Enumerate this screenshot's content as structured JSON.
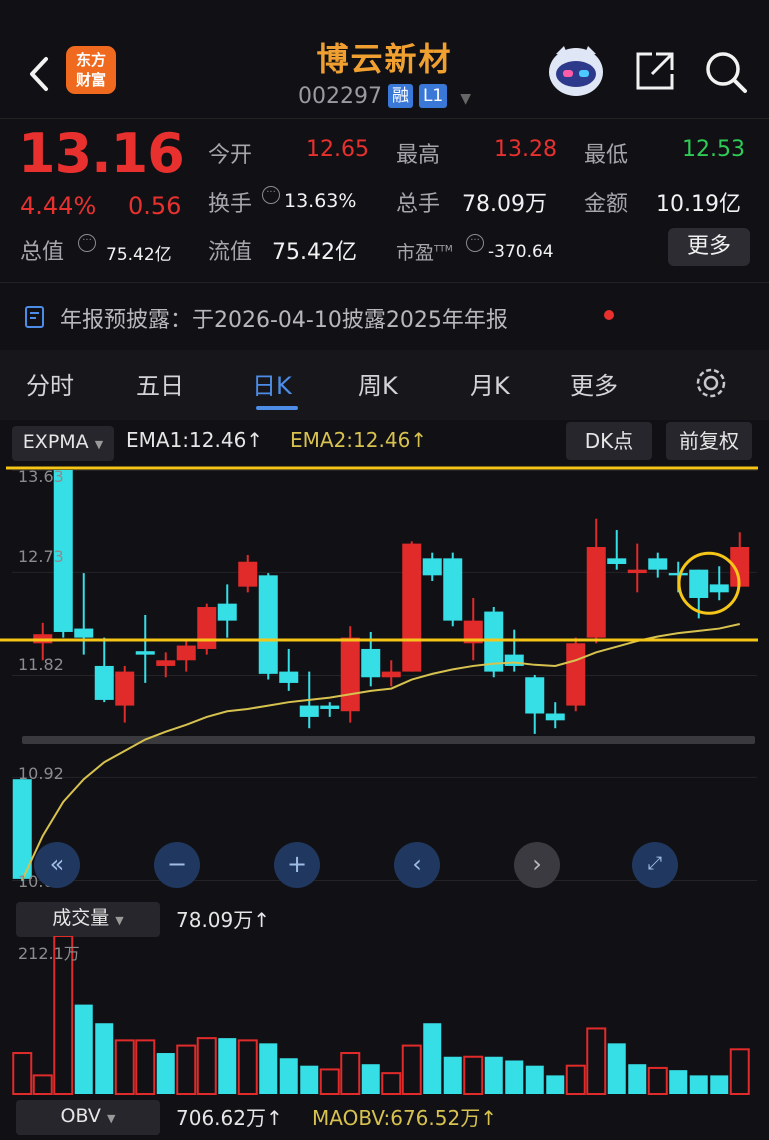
{
  "header": {
    "title": "博云新材",
    "code": "002297",
    "tag_margin": "融",
    "tag_level": "L1",
    "logo_line1": "东方",
    "logo_line2": "财富"
  },
  "quote": {
    "price": "13.16",
    "change_pct": "4.44%",
    "change_amt": "0.56",
    "open_label": "今开",
    "open": "12.65",
    "high_label": "最高",
    "high": "13.28",
    "low_label": "最低",
    "low": "12.53",
    "turnover_label": "换手",
    "turnover": "13.63%",
    "volume_label": "总手",
    "volume": "78.09万",
    "amount_label": "金额",
    "amount": "10.19亿",
    "mktcap_label": "总值",
    "mktcap": "75.42亿",
    "float_label": "流值",
    "float_cap": "75.42亿",
    "pe_label": "市盈",
    "pe_sup": "TTM",
    "pe": "-370.64",
    "more_label": "更多"
  },
  "notice": {
    "text": "年报预披露：于2026-04-10披露2025年年报"
  },
  "tabs": [
    {
      "label": "分时",
      "active": false
    },
    {
      "label": "五日",
      "active": false
    },
    {
      "label": "日K",
      "active": true
    },
    {
      "label": "周K",
      "active": false
    },
    {
      "label": "月K",
      "active": false
    },
    {
      "label": "更多",
      "active": false
    }
  ],
  "indicator": {
    "name": "EXPMA",
    "ema1": "EMA1:12.46",
    "ema2": "EMA2:12.46",
    "arrow": "↑",
    "dk": "DK点",
    "adjust": "前复权"
  },
  "volume_panel": {
    "name": "成交量",
    "value": "78.09万",
    "arrow": "↑",
    "max_label": "212.1万"
  },
  "obv_panel": {
    "name": "OBV",
    "obv": "706.62万",
    "maobv": "MAOBV:676.52万",
    "arrow": "↑"
  },
  "chart_data": {
    "type": "candlestick",
    "y_ticks": [
      "13.63",
      "12.73",
      "11.82",
      "10.92",
      "10.01"
    ],
    "ylim": [
      10.01,
      13.63
    ],
    "candles": [
      {
        "o": 10.9,
        "h": 10.9,
        "l": 10.0,
        "c": 10.02,
        "up": false
      },
      {
        "o": 12.1,
        "h": 12.28,
        "l": 11.95,
        "c": 12.18,
        "up": true
      },
      {
        "o": 13.63,
        "h": 13.63,
        "l": 12.15,
        "c": 12.2,
        "up": false
      },
      {
        "o": 12.23,
        "h": 12.72,
        "l": 12.0,
        "c": 12.15,
        "up": false
      },
      {
        "o": 11.9,
        "h": 12.15,
        "l": 11.58,
        "c": 11.6,
        "up": false
      },
      {
        "o": 11.55,
        "h": 11.9,
        "l": 11.4,
        "c": 11.85,
        "up": true
      },
      {
        "o": 12.0,
        "h": 12.35,
        "l": 11.75,
        "c": 12.03,
        "up": false
      },
      {
        "o": 11.9,
        "h": 12.02,
        "l": 11.8,
        "c": 11.95,
        "up": true
      },
      {
        "o": 11.95,
        "h": 12.12,
        "l": 11.85,
        "c": 12.08,
        "up": true
      },
      {
        "o": 12.05,
        "h": 12.45,
        "l": 12.0,
        "c": 12.42,
        "up": true
      },
      {
        "o": 12.45,
        "h": 12.62,
        "l": 12.15,
        "c": 12.3,
        "up": false
      },
      {
        "o": 12.6,
        "h": 12.88,
        "l": 12.55,
        "c": 12.82,
        "up": true
      },
      {
        "o": 12.7,
        "h": 12.72,
        "l": 11.78,
        "c": 11.83,
        "up": false
      },
      {
        "o": 11.85,
        "h": 12.05,
        "l": 11.68,
        "c": 11.75,
        "up": false
      },
      {
        "o": 11.55,
        "h": 11.85,
        "l": 11.35,
        "c": 11.45,
        "up": false
      },
      {
        "o": 11.52,
        "h": 11.58,
        "l": 11.45,
        "c": 11.55,
        "up": false
      },
      {
        "o": 11.5,
        "h": 12.25,
        "l": 11.4,
        "c": 12.15,
        "up": true
      },
      {
        "o": 12.05,
        "h": 12.2,
        "l": 11.72,
        "c": 11.8,
        "up": false
      },
      {
        "o": 11.8,
        "h": 11.95,
        "l": 11.72,
        "c": 11.85,
        "up": true
      },
      {
        "o": 11.85,
        "h": 13.0,
        "l": 11.85,
        "c": 12.98,
        "up": true
      },
      {
        "o": 12.85,
        "h": 12.9,
        "l": 12.65,
        "c": 12.7,
        "up": false
      },
      {
        "o": 12.85,
        "h": 12.9,
        "l": 12.25,
        "c": 12.3,
        "up": false
      },
      {
        "o": 12.3,
        "h": 12.5,
        "l": 11.95,
        "c": 12.1,
        "up": true
      },
      {
        "o": 12.38,
        "h": 12.42,
        "l": 11.8,
        "c": 11.85,
        "up": false
      },
      {
        "o": 12.0,
        "h": 12.22,
        "l": 11.85,
        "c": 11.9,
        "up": false
      },
      {
        "o": 11.8,
        "h": 11.82,
        "l": 11.3,
        "c": 11.48,
        "up": false
      },
      {
        "o": 11.48,
        "h": 11.58,
        "l": 11.35,
        "c": 11.42,
        "up": false
      },
      {
        "o": 11.55,
        "h": 12.15,
        "l": 11.5,
        "c": 12.1,
        "up": true
      },
      {
        "o": 12.15,
        "h": 13.2,
        "l": 12.1,
        "c": 12.95,
        "up": true
      },
      {
        "o": 12.85,
        "h": 13.1,
        "l": 12.75,
        "c": 12.8,
        "up": false
      },
      {
        "o": 12.75,
        "h": 12.98,
        "l": 12.55,
        "c": 12.72,
        "up": true
      },
      {
        "o": 12.85,
        "h": 12.9,
        "l": 12.68,
        "c": 12.75,
        "up": false
      },
      {
        "o": 12.72,
        "h": 12.82,
        "l": 12.55,
        "c": 12.7,
        "up": false
      },
      {
        "o": 12.75,
        "h": 12.75,
        "l": 12.32,
        "c": 12.5,
        "up": false
      },
      {
        "o": 12.62,
        "h": 12.78,
        "l": 12.48,
        "c": 12.55,
        "up": false
      },
      {
        "o": 12.6,
        "h": 13.08,
        "l": 12.6,
        "c": 12.95,
        "up": true
      }
    ],
    "ema": [
      10.01,
      10.4,
      10.7,
      10.9,
      11.05,
      11.15,
      11.25,
      11.32,
      11.38,
      11.45,
      11.5,
      11.52,
      11.55,
      11.58,
      11.6,
      11.62,
      11.65,
      11.68,
      11.7,
      11.78,
      11.83,
      11.87,
      11.9,
      11.92,
      11.93,
      11.91,
      11.9,
      11.95,
      12.02,
      12.07,
      12.12,
      12.16,
      12.19,
      12.21,
      12.23,
      12.27
    ],
    "volume": [
      {
        "v": 0.55,
        "up": true
      },
      {
        "v": 0.25,
        "up": true
      },
      {
        "v": 2.121,
        "up": true
      },
      {
        "v": 1.2,
        "up": false
      },
      {
        "v": 0.95,
        "up": false
      },
      {
        "v": 0.72,
        "up": true
      },
      {
        "v": 0.72,
        "up": true
      },
      {
        "v": 0.55,
        "up": false
      },
      {
        "v": 0.65,
        "up": true
      },
      {
        "v": 0.75,
        "up": true
      },
      {
        "v": 0.75,
        "up": false
      },
      {
        "v": 0.72,
        "up": true
      },
      {
        "v": 0.68,
        "up": false
      },
      {
        "v": 0.48,
        "up": false
      },
      {
        "v": 0.38,
        "up": false
      },
      {
        "v": 0.33,
        "up": true
      },
      {
        "v": 0.55,
        "up": true
      },
      {
        "v": 0.4,
        "up": false
      },
      {
        "v": 0.28,
        "up": true
      },
      {
        "v": 0.65,
        "up": true
      },
      {
        "v": 0.95,
        "up": false
      },
      {
        "v": 0.5,
        "up": false
      },
      {
        "v": 0.5,
        "up": true
      },
      {
        "v": 0.5,
        "up": false
      },
      {
        "v": 0.45,
        "up": false
      },
      {
        "v": 0.38,
        "up": false
      },
      {
        "v": 0.25,
        "up": false
      },
      {
        "v": 0.38,
        "up": true
      },
      {
        "v": 0.88,
        "up": true
      },
      {
        "v": 0.68,
        "up": false
      },
      {
        "v": 0.4,
        "up": false
      },
      {
        "v": 0.35,
        "up": true
      },
      {
        "v": 0.32,
        "up": false
      },
      {
        "v": 0.25,
        "up": false
      },
      {
        "v": 0.25,
        "up": false
      },
      {
        "v": 0.6,
        "up": true
      }
    ],
    "volume_max": 2.121,
    "colors": {
      "up": "#e12b2b",
      "down": "#36dfe6",
      "ema": "#d7c250",
      "annotation": "#f5c518"
    },
    "annotations": {
      "upper_line": 13.63,
      "lower_line": 12.2,
      "circle_on_candles": [
        33,
        34
      ]
    }
  }
}
